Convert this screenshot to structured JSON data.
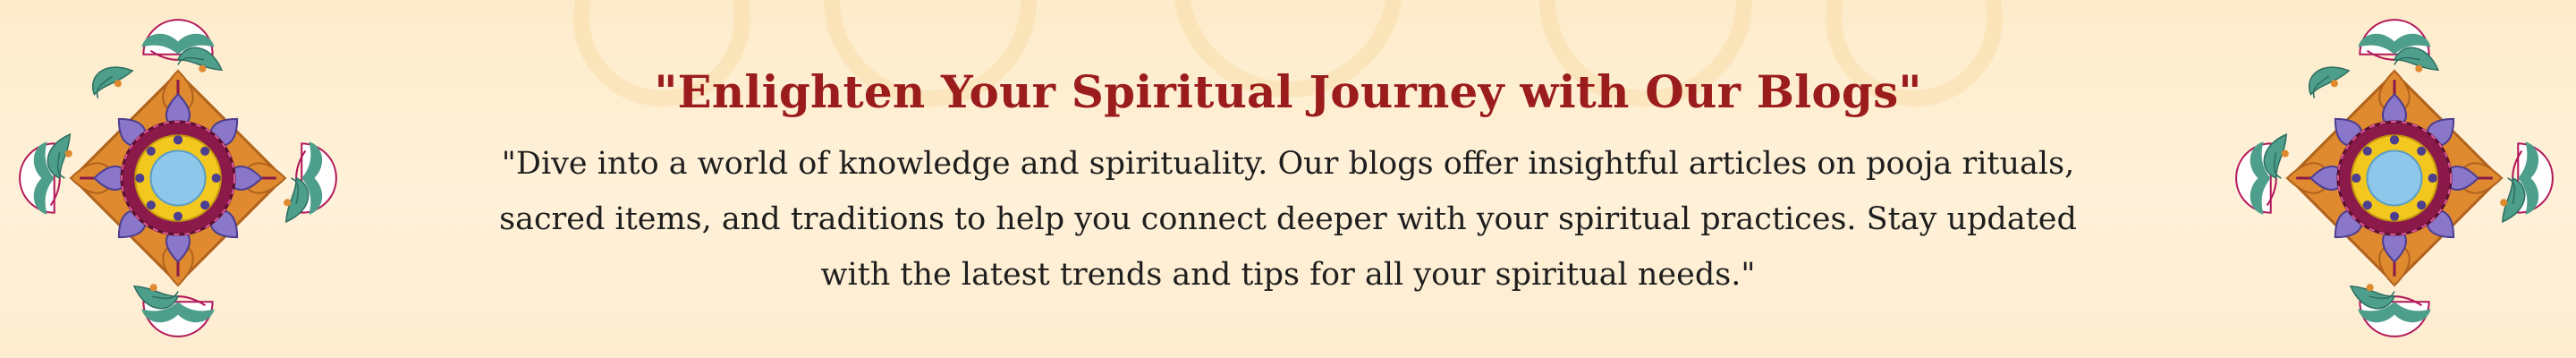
{
  "banner": {
    "heading": "\"Enlighten Your Spiritual Journey with Our Blogs\"",
    "description": "\"Dive into a world of knowledge and spirituality. Our blogs offer insightful articles on pooja rituals, sacred items, and traditions to help you connect deeper with your spiritual practices. Stay updated with the latest trends and tips for all your spiritual needs.\""
  },
  "decorations": {
    "left": "rangoli-icon",
    "right": "rangoli-icon",
    "watermark": "mandala-watermark-icon"
  },
  "colors": {
    "heading": "#9b1c1c",
    "text": "#1e1e1e",
    "background": "#fdeccb",
    "rangoli_maroon": "#8b1a4a",
    "rangoli_orange": "#e08a30",
    "rangoli_teal": "#4e9e8c",
    "rangoli_purple": "#8a77c9",
    "rangoli_yellow": "#f2c81e",
    "rangoli_blue": "#8ec7ea"
  }
}
